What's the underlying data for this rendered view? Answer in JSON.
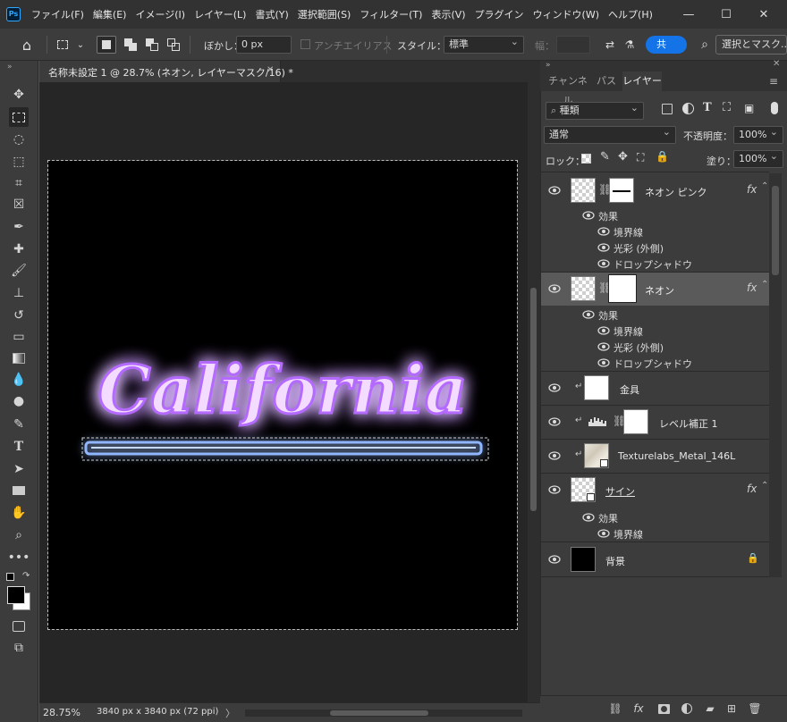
{
  "app": {
    "logo": "Ps"
  },
  "menu": [
    "ファイル(F)",
    "編集(E)",
    "イメージ(I)",
    "レイヤー(L)",
    "書式(Y)",
    "選択範囲(S)",
    "フィルター(T)",
    "表示(V)",
    "プラグイン",
    "ウィンドウ(W)",
    "ヘルプ(H)"
  ],
  "window_controls": {
    "minimize": "—",
    "maximize": "☐",
    "close": "✕"
  },
  "options": {
    "feather_label": "ぼかし：",
    "feather_value": "0 px",
    "antialias_label": "アンチエイリアス",
    "style_label": "スタイル：",
    "style_value": "標準",
    "width_label": "幅：",
    "share_label": "共",
    "select_mask_label": "選択とマスク..."
  },
  "document": {
    "tab_title": "名称未設定 1 @ 28.7% (ネオン, レイヤーマスク/16) *",
    "tab_close": "✕",
    "neon_text": "California",
    "zoom": "28.75%",
    "size_info": "3840 px x 3840 px (72 ppi)",
    "status_arrow": "〉"
  },
  "panel": {
    "tabs": [
      "チャンネル",
      "パス",
      "レイヤー"
    ],
    "active_tab": "レイヤー",
    "filter_value": "種類",
    "blend_mode": "通常",
    "opacity_label": "不透明度：",
    "opacity_value": "100%",
    "lock_label": "ロック：",
    "fill_label": "塗り：",
    "fill_value": "100%"
  },
  "layers": [
    {
      "name": "ネオン ピンク",
      "fx": "fx",
      "effects_label": "効果",
      "effects": [
        "境界線",
        "光彩 (外側)",
        "ドロップシャドウ"
      ]
    },
    {
      "name": "ネオン",
      "fx": "fx",
      "effects_label": "効果",
      "effects": [
        "境界線",
        "光彩 (外側)",
        "ドロップシャドウ"
      ]
    },
    {
      "name": "金具"
    },
    {
      "name": "レベル補正 1"
    },
    {
      "name": "Texturelabs_Metal_146L"
    },
    {
      "name": "サイン",
      "fx": "fx",
      "effects_label": "効果",
      "effects": [
        "境界線"
      ]
    },
    {
      "name": "背景"
    }
  ],
  "colors": {
    "neon_purple": "#c98cff",
    "neon_blue": "#6fa0ff",
    "accent": "#1473e6"
  }
}
